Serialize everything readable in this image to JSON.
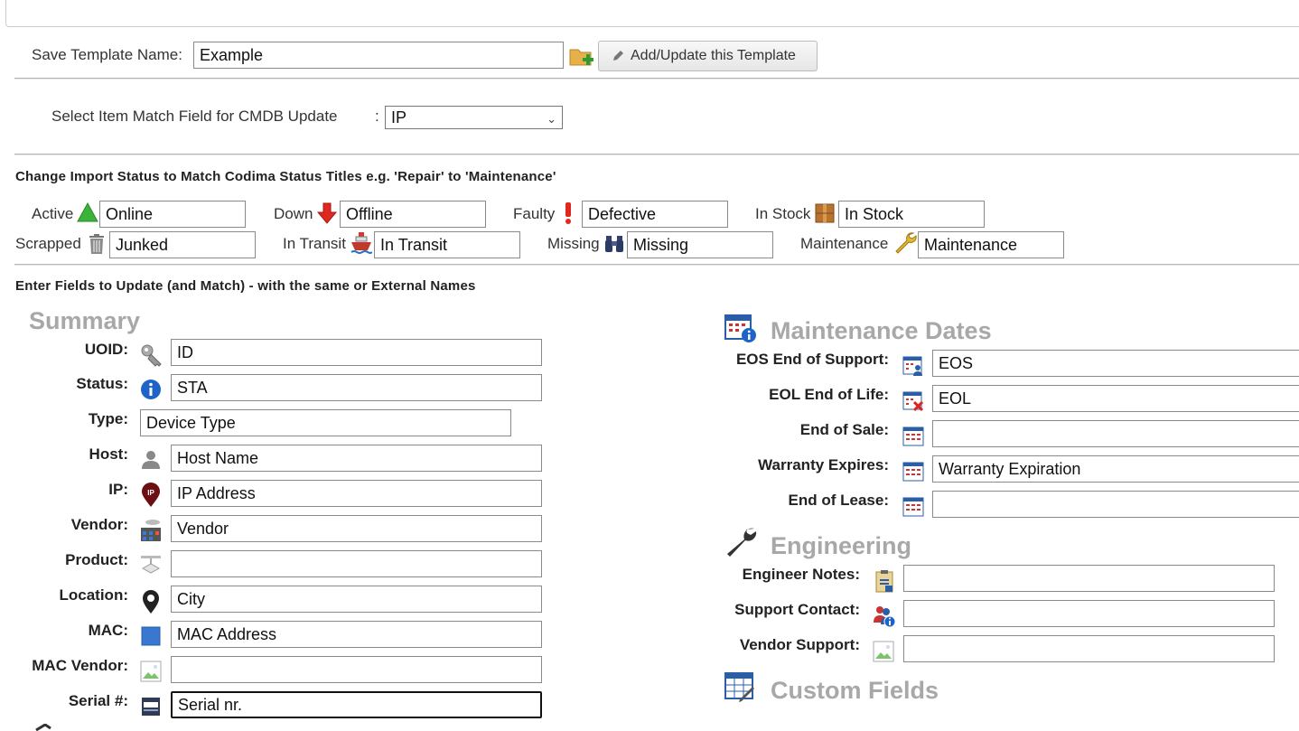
{
  "template": {
    "label": "Save Template Name:",
    "name_value": "Example",
    "add_button_label": "Add/Update this Template"
  },
  "match": {
    "label": "Select Item Match Field for CMDB Update",
    "colon": ":",
    "selected": "IP"
  },
  "status_section": {
    "heading": "Change Import Status to Match Codima Status Titles e.g. 'Repair' to 'Maintenance'",
    "items": [
      {
        "label": "Active",
        "icon": "triangle-up-green-icon",
        "value": "Online"
      },
      {
        "label": "Down",
        "icon": "arrow-down-red-icon",
        "value": "Offline"
      },
      {
        "label": "Faulty",
        "icon": "exclamation-red-icon",
        "value": "Defective"
      },
      {
        "label": "In Stock",
        "icon": "box-icon",
        "value": "In Stock"
      },
      {
        "label": "Scrapped",
        "icon": "trash-icon",
        "value": "Junked"
      },
      {
        "label": "In Transit",
        "icon": "ship-icon",
        "value": "In Transit"
      },
      {
        "label": "Missing",
        "icon": "binoculars-icon",
        "value": "Missing"
      },
      {
        "label": "Maintenance",
        "icon": "wrench-icon",
        "value": "Maintenance"
      }
    ]
  },
  "fields_section": {
    "heading": "Enter Fields to Update (and Match) - with the same or External Names"
  },
  "summary": {
    "title": "Summary",
    "fields": [
      {
        "label": "UOID:",
        "icon": "key-icon",
        "value": ""
      },
      {
        "label": "Status:",
        "icon": "info-icon",
        "value": "STA"
      },
      {
        "label": "Type:",
        "icon": "",
        "value": "Device Type"
      },
      {
        "label": "Host:",
        "icon": "user-icon",
        "value": "Host Name"
      },
      {
        "label": "IP:",
        "icon": "ip-pin-icon",
        "value": "IP Address"
      },
      {
        "label": "Vendor:",
        "icon": "factory-icon",
        "value": "Vendor"
      },
      {
        "label": "Product:",
        "icon": "product-icon",
        "value": ""
      },
      {
        "label": "Location:",
        "icon": "map-pin-icon",
        "value": "City"
      },
      {
        "label": "MAC:",
        "icon": "mac-square-icon",
        "value": "MAC Address"
      },
      {
        "label": "MAC Vendor:",
        "icon": "broken-image-icon",
        "value": ""
      },
      {
        "label": "Serial #:",
        "icon": "serial-icon",
        "value": "Serial nr."
      }
    ],
    "uoid_value": "ID"
  },
  "maintenance": {
    "title": "Maintenance Dates",
    "fields": [
      {
        "label": "EOS End of Support:",
        "icon": "calendar-user-icon",
        "value": "EOS"
      },
      {
        "label": "EOL End of Life:",
        "icon": "calendar-x-icon",
        "value": "EOL"
      },
      {
        "label": "End of Sale:",
        "icon": "calendar-icon",
        "value": ""
      },
      {
        "label": "Warranty Expires:",
        "icon": "calendar-icon",
        "value": "Warranty Expiration"
      },
      {
        "label": "End of Lease:",
        "icon": "calendar-icon",
        "value": ""
      }
    ]
  },
  "engineering": {
    "title": "Engineering",
    "fields": [
      {
        "label": "Engineer Notes:",
        "icon": "clipboard-icon",
        "value": ""
      },
      {
        "label": "Support Contact:",
        "icon": "contacts-info-icon",
        "value": ""
      },
      {
        "label": "Vendor Support:",
        "icon": "broken-image-icon",
        "value": ""
      }
    ]
  },
  "custom": {
    "title": "Custom Fields"
  },
  "colors": {
    "title_grey": "#a8a8a8",
    "border": "#8a8a8a"
  }
}
